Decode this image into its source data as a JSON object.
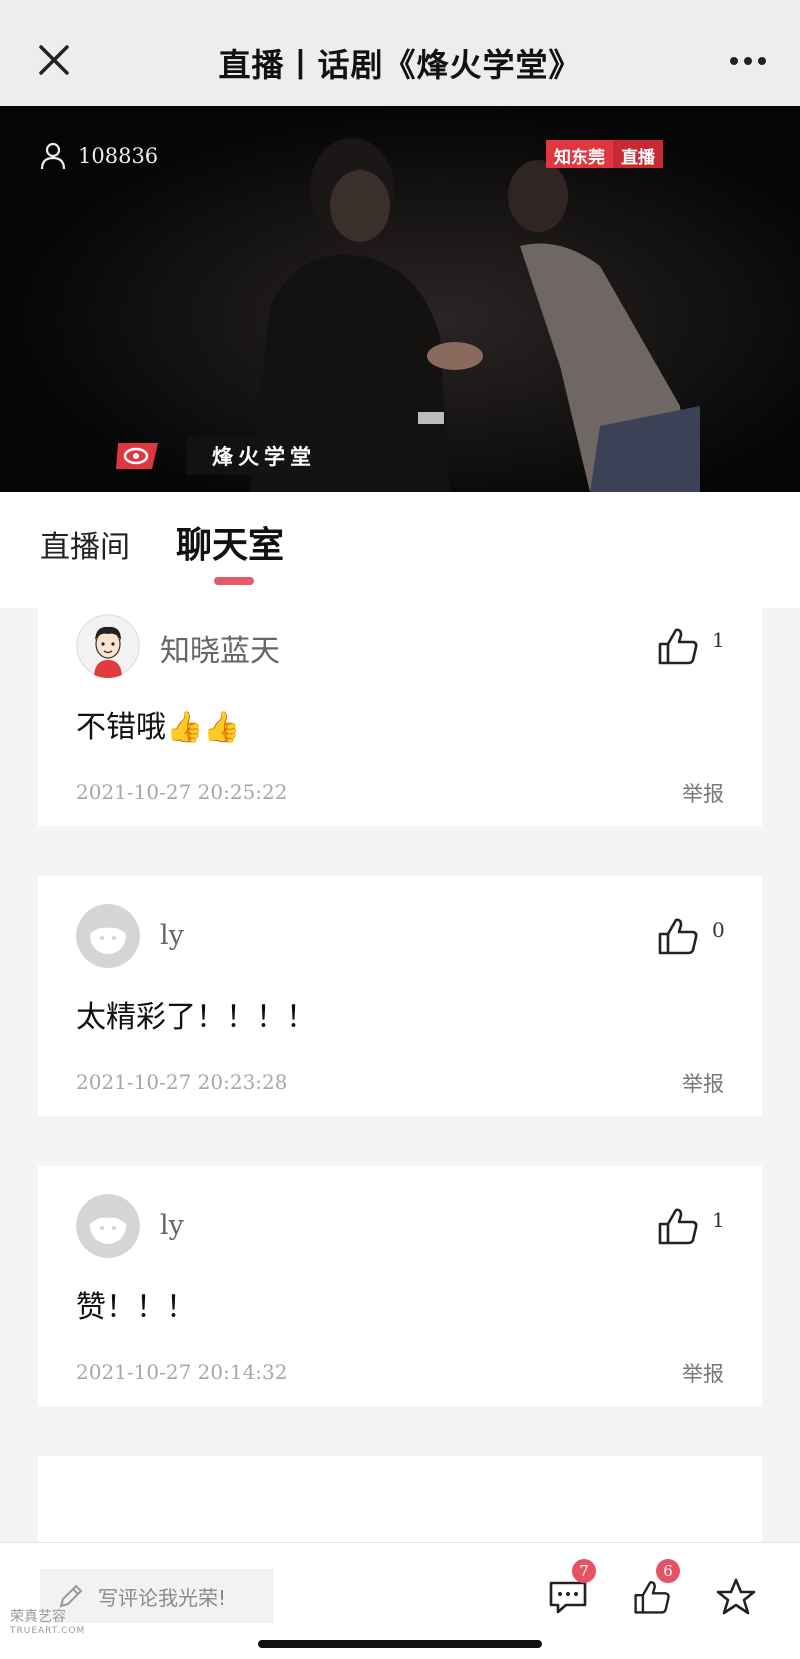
{
  "header": {
    "title": "直播丨话剧《烽火学堂》",
    "close_icon": "close-icon",
    "more_icon": "more-icon"
  },
  "video": {
    "viewer_count": "108836",
    "live_badge_brand": "知东莞",
    "live_badge_live": "直播",
    "show_title": "烽火学堂"
  },
  "tabs": [
    {
      "label": "直播间",
      "active": false
    },
    {
      "label": "聊天室",
      "active": true
    }
  ],
  "comments": [
    {
      "user": "知晓蓝天",
      "likes": "1",
      "text": "不错哦👍👍",
      "time": "2021-10-27 20:25:22",
      "report": "举报"
    },
    {
      "user": "ly",
      "likes": "0",
      "text": "太精彩了！！！！",
      "time": "2021-10-27 20:23:28",
      "report": "举报"
    },
    {
      "user": "ly",
      "likes": "1",
      "text": "赞！！！",
      "time": "2021-10-27 20:14:32",
      "report": "举报"
    }
  ],
  "bottom": {
    "input_placeholder": "写评论我光荣!",
    "comment_badge": "7",
    "like_badge": "6"
  },
  "watermark": {
    "line1": "荣真艺容",
    "line2": "TRUEART.COM"
  },
  "colors": {
    "accent": "#e55a6b",
    "live_red": "#e0363f"
  }
}
